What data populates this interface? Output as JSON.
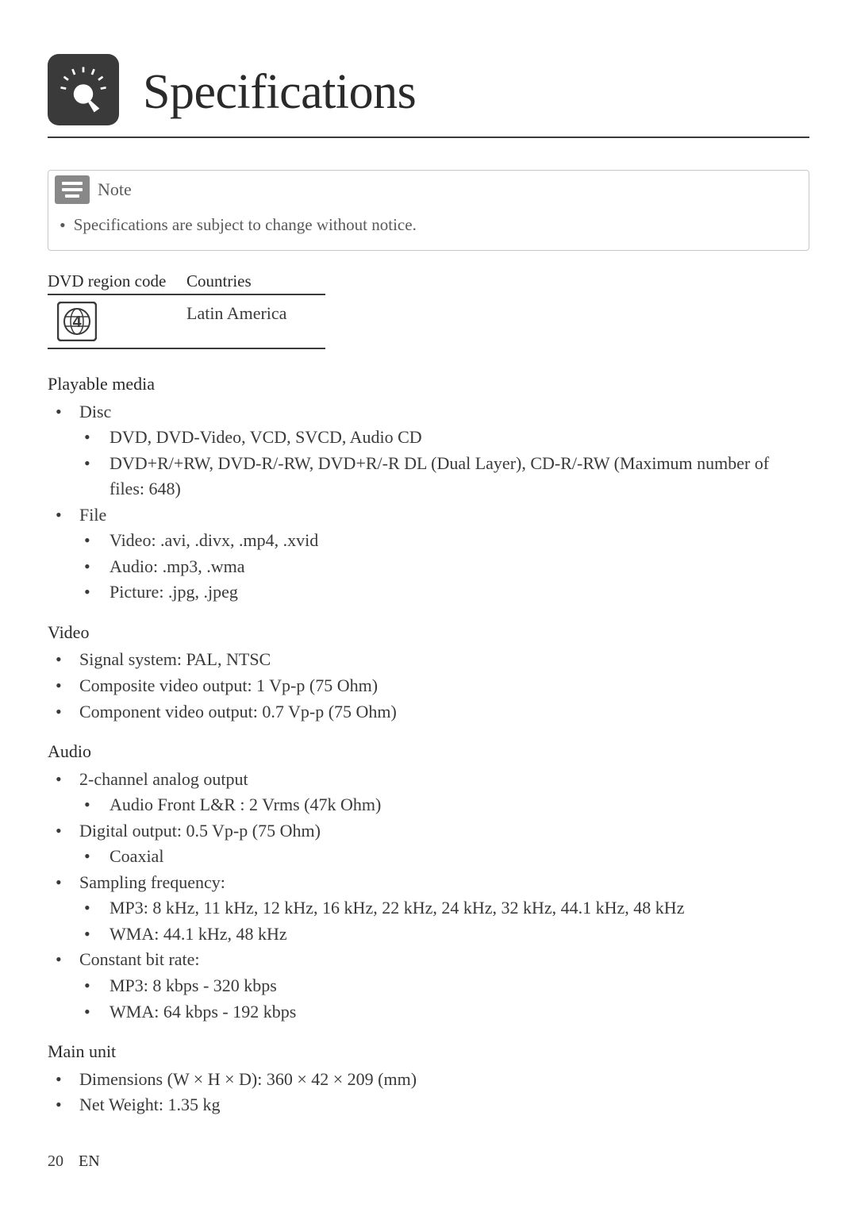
{
  "page_title": "Specifications",
  "note": {
    "label": "Note",
    "items": [
      "Specifications are subject to change without notice."
    ]
  },
  "region_table": {
    "header1": "DVD region code",
    "header2": "Countries",
    "region_number": "4",
    "country": "Latin America"
  },
  "sections": {
    "playable_media": {
      "title": "Playable media",
      "disc_label": "Disc",
      "disc_items": [
        "DVD, DVD-Video, VCD, SVCD, Audio CD",
        "DVD+R/+RW, DVD-R/-RW, DVD+R/-R DL (Dual Layer), CD-R/-RW (Maximum number of files: 648)"
      ],
      "file_label": "File",
      "file_items": [
        "Video: .avi, .divx, .mp4, .xvid",
        "Audio: .mp3, .wma",
        "Picture: .jpg, .jpeg"
      ]
    },
    "video": {
      "title": "Video",
      "items": [
        "Signal system: PAL, NTSC",
        "Composite video output: 1 Vp-p (75 Ohm)",
        "Component video output: 0.7 Vp-p (75 Ohm)"
      ]
    },
    "audio": {
      "title": "Audio",
      "analog_label": "2-channel analog output",
      "analog_items": [
        "Audio Front L&R : 2 Vrms (47k Ohm)"
      ],
      "digital_label": "Digital output: 0.5 Vp-p (75 Ohm)",
      "digital_items": [
        "Coaxial"
      ],
      "sampling_label": "Sampling frequency:",
      "sampling_items": [
        "MP3: 8 kHz, 11 kHz, 12 kHz, 16 kHz, 22 kHz, 24 kHz, 32 kHz, 44.1 kHz, 48 kHz",
        "WMA: 44.1 kHz, 48 kHz"
      ],
      "bitrate_label": "Constant bit rate:",
      "bitrate_items": [
        "MP3: 8 kbps - 320 kbps",
        "WMA: 64 kbps - 192 kbps"
      ]
    },
    "main_unit": {
      "title": "Main unit",
      "items": [
        "Dimensions (W × H × D): 360 × 42 × 209 (mm)",
        "Net Weight: 1.35 kg"
      ]
    }
  },
  "footer": {
    "page_number": "20",
    "lang": "EN"
  }
}
